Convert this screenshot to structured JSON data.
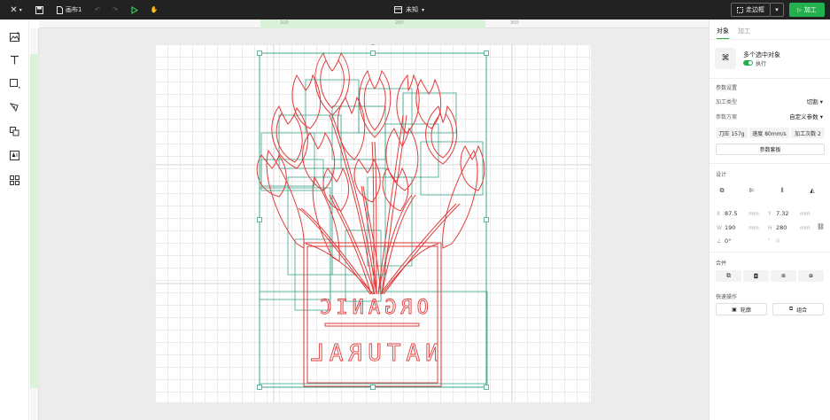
{
  "topbar": {
    "logo": "✕",
    "canvas_name": "画布1",
    "center_title": "未知",
    "frame_label": "走边框",
    "process_label": "加工"
  },
  "ruler": {
    "ticks": [
      "100",
      "200",
      "300"
    ]
  },
  "panel": {
    "tabs": [
      "对象",
      "加工"
    ],
    "selection_title": "多个选中对象",
    "toggle_label": "执行",
    "param_settings": "参数设置",
    "process_type_label": "加工类型",
    "process_type_value": "切割",
    "param_scheme_label": "参数方案",
    "param_scheme_value": "自定义参数",
    "chip_pressure": "刀压 157g",
    "chip_speed": "速度 80mm/s",
    "chip_count": "加工次数 2",
    "param_store": "参数套板",
    "design_label": "设计",
    "x_label": "X",
    "x_value": "87.5",
    "x_unit": "mm",
    "y_label": "Y",
    "y_value": "7.32",
    "y_unit": "mm",
    "w_label": "W",
    "w_value": "190",
    "w_unit": "mm",
    "h_label": "H",
    "h_value": "280",
    "h_unit": "mm",
    "rotate_value": "0°",
    "radius_value": "0",
    "combine_label": "合并",
    "quick_label": "快速操作",
    "outline_label": "轮廓",
    "group_label": "组合"
  },
  "artwork": {
    "text_top": "ORGANIC",
    "text_bottom": "NATURAL",
    "stroke_color": "#e23b3b",
    "box_color": "#3aa58a"
  }
}
